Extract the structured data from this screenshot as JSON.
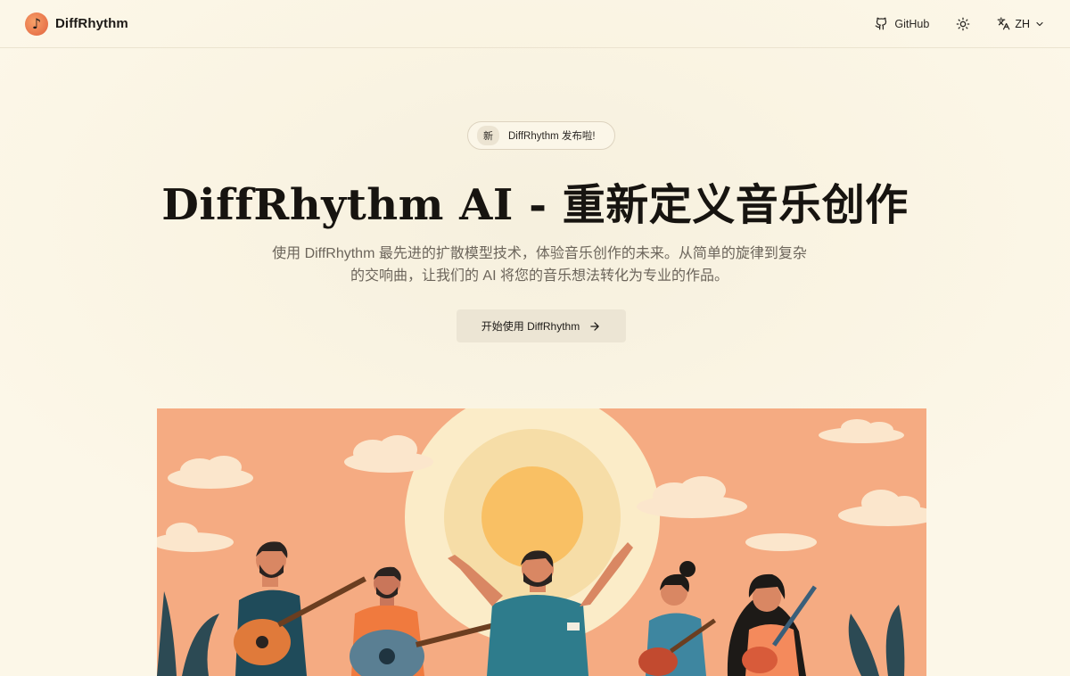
{
  "header": {
    "brand_name": "DiffRhythm",
    "github_label": "GitHub",
    "lang_label": "ZH"
  },
  "hero": {
    "badge_tag": "新",
    "badge_text": "DiffRhythm 发布啦!",
    "title": "DiffRhythm AI - 重新定义音乐创作",
    "description_line1": "使用 DiffRhythm 最先进的扩散模型技术，体验音乐创作的未来。从简单的旋律到复杂",
    "description_line2": "的交响曲，让我们的 AI 将您的音乐想法转化为专业的作品。",
    "cta_label": "开始使用 DiffRhythm"
  },
  "icons": {
    "logo": "music-note-icon",
    "github": "github-icon",
    "theme": "sun-icon",
    "language": "translate-icon",
    "dropdown": "chevron-down-icon",
    "cta_arrow": "arrow-right-icon"
  },
  "colors": {
    "background": "#fbf5e4",
    "accent": "#e8744a",
    "illustration_sky": "#f5ab82",
    "sun": "#f9c064"
  }
}
